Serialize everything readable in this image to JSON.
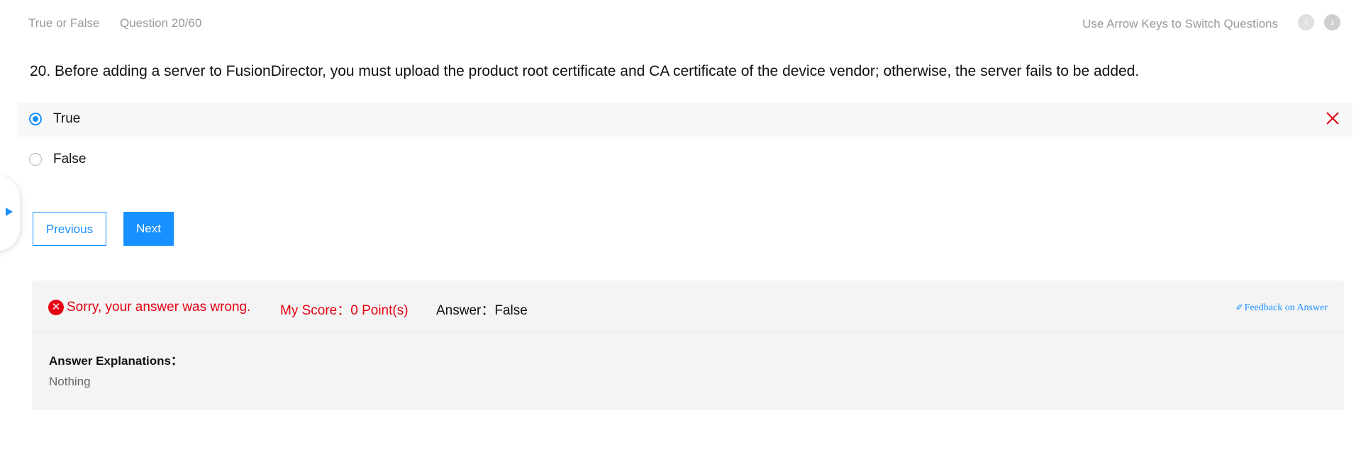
{
  "header": {
    "question_type": "True or False",
    "question_counter": "Question 20/60",
    "hint": "Use Arrow Keys to Switch Questions",
    "prev_icon": "chevron-left-icon",
    "next_icon": "chevron-right-icon"
  },
  "question": {
    "text": "20. Before adding a server to FusionDirector, you must upload the product root certificate and CA certificate of the device vendor; otherwise, the server fails to be added."
  },
  "options": [
    {
      "label": "True",
      "selected": true,
      "marked_wrong": true
    },
    {
      "label": "False",
      "selected": false,
      "marked_wrong": false
    }
  ],
  "side_panel": {
    "icon": "play-triangle-icon"
  },
  "buttons": {
    "previous": "Previous",
    "next": "Next"
  },
  "result": {
    "status_icon": "close-circle-icon",
    "message": "Sorry, your answer was wrong.",
    "score": "My Score：0 Point(s)",
    "answer": "Answer：False",
    "feedback_link": "Feedback on Answer",
    "feedback_icon": "edit-pen-icon",
    "explanation_title": "Answer Explanations：",
    "explanation_body": "Nothing"
  },
  "colors": {
    "accent": "#1890ff",
    "error": "#e60012",
    "muted_text": "#999999",
    "panel_background": "#f4f4f4"
  }
}
